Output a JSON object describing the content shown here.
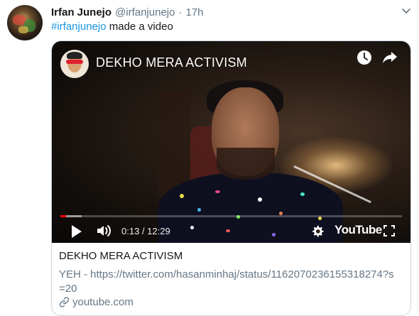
{
  "author": {
    "name": "Irfan Junejo",
    "handle": "@irfanjunejo",
    "separator": "·",
    "time": "17h"
  },
  "tweet": {
    "hashtag": "#irfanjunejo",
    "text": " made a video"
  },
  "video": {
    "title": "DEKHO MERA ACTIVISM",
    "current_time": "0:13",
    "duration_separator": " / ",
    "duration": "12:29",
    "progress_fraction": 0.017,
    "buffered_fraction": 0.063,
    "brand": "YouTube"
  },
  "card": {
    "title": "DEKHO MERA ACTIVISM",
    "description": "YEH - https://twitter.com/hasanminhaj/status/1162070236155318274?s=20",
    "domain": "youtube.com"
  },
  "colors": {
    "link": "#1b95e0",
    "secondary_text": "#657786",
    "progress": "#ff0000",
    "border": "#ccd6dd"
  },
  "icons": [
    "caret-down-icon",
    "watch-later-icon",
    "share-icon",
    "play-icon",
    "volume-icon",
    "settings-icon",
    "fullscreen-icon",
    "link-icon"
  ]
}
